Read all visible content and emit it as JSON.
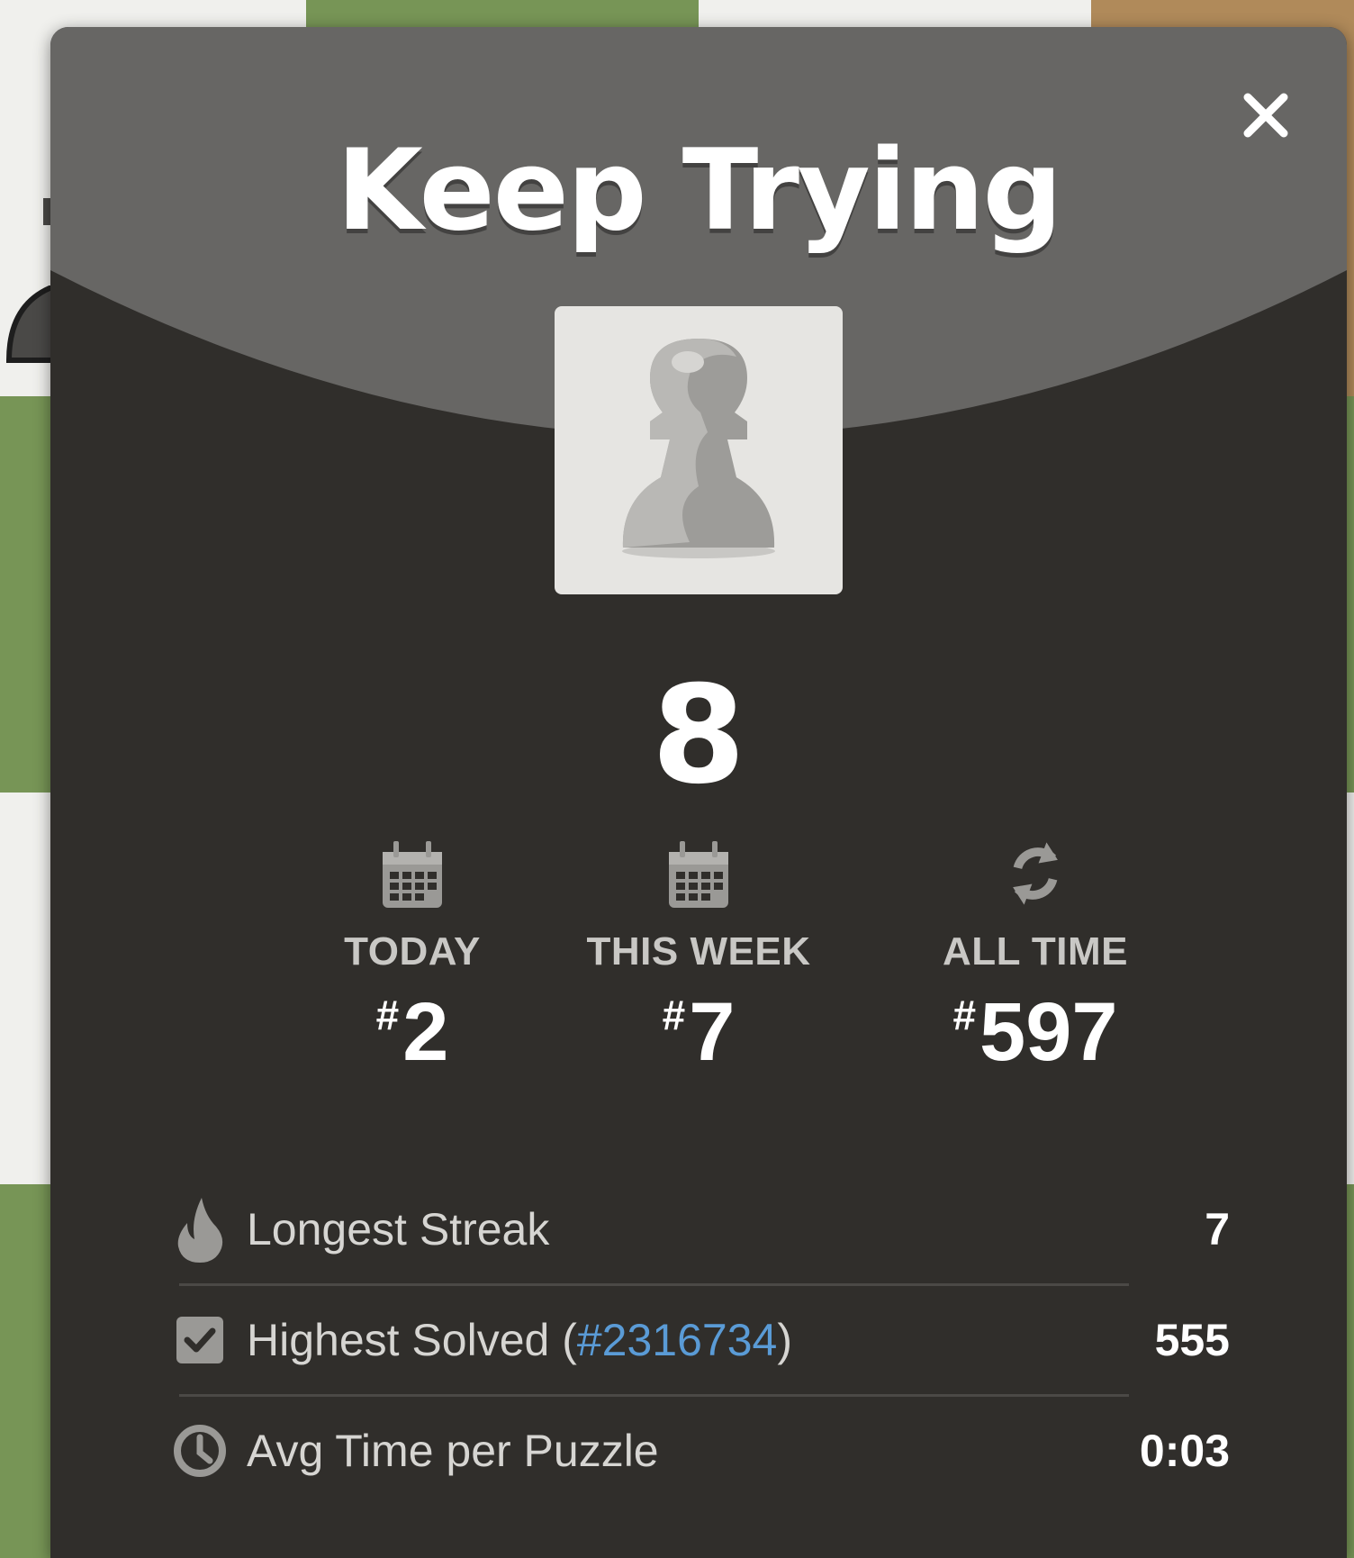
{
  "modal": {
    "title": "Keep Trying",
    "score": "8",
    "close_icon": "close-icon",
    "piece_icon": "white-pawn-icon"
  },
  "ranks": [
    {
      "label": "TODAY",
      "hash": "#",
      "value": "2",
      "icon": "calendar-icon"
    },
    {
      "label": "THIS WEEK",
      "hash": "#",
      "value": "7",
      "icon": "calendar-icon"
    },
    {
      "label": "ALL TIME",
      "hash": "#",
      "value": "597",
      "icon": "refresh-icon"
    }
  ],
  "stats": {
    "longest_streak": {
      "label": "Longest Streak",
      "value": "7",
      "icon": "flame-icon"
    },
    "highest_solved": {
      "label_prefix": "Highest Solved (",
      "link": "#2316734",
      "label_suffix": ")",
      "value": "555",
      "icon": "checkbox-icon"
    },
    "avg_time": {
      "label": "Avg Time per Puzzle",
      "value": "0:03",
      "icon": "clock-icon"
    }
  },
  "colors": {
    "board_light": "#ebecd0",
    "board_dark": "#779556",
    "modal_bg": "#302e2b",
    "modal_arc": "#676664",
    "link": "#5a9bd6"
  }
}
